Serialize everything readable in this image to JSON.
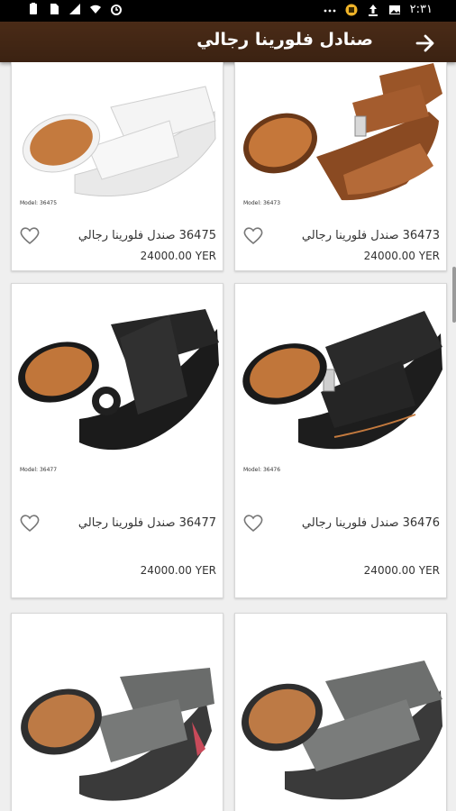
{
  "status_bar": {
    "time": "٢:٣١",
    "left_icons": [
      "battery-icon",
      "sim-icon",
      "network-icon",
      "wifi-icon",
      "alarm-icon"
    ],
    "right_icons": [
      "more-dots-icon",
      "app-badge-icon",
      "upload-icon",
      "image-icon"
    ]
  },
  "app_bar": {
    "title": "صنادل فلورينا رجالي",
    "back_icon": "arrow-right-icon"
  },
  "products": [
    {
      "model": "Model: 36473",
      "name": "36473 صندل فلورينا رجالي",
      "price": "24000.00 YER",
      "color": "tan-brown"
    },
    {
      "model": "Model: 36475",
      "name": "36475 صندل فلورينا رجالي",
      "price": "24000.00 YER",
      "color": "white"
    },
    {
      "model": "Model: 36476",
      "name": "36476 صندل فلورينا رجالي",
      "price": "24000.00 YER",
      "color": "black"
    },
    {
      "model": "Model: 36477",
      "name": "36477 صندل فلورينا رجالي",
      "price": "24000.00 YER",
      "color": "black"
    },
    {
      "model": "",
      "name": "",
      "price": "",
      "color": "gray"
    },
    {
      "model": "",
      "name": "",
      "price": "",
      "color": "gray"
    }
  ],
  "colors": {
    "app_bar": "#3f2414",
    "background": "#efefef",
    "card": "#ffffff",
    "sole_orange": "#c77a3a"
  }
}
